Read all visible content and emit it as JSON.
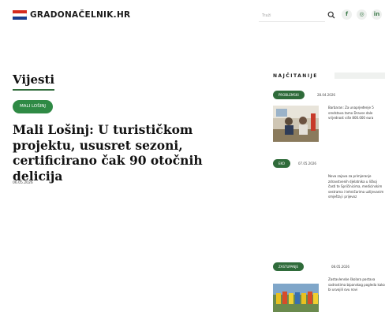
{
  "header": {
    "logo_text": "GRADONAČELNIK.HR",
    "search_placeholder": "Traži",
    "social": [
      {
        "icon": "facebook-icon",
        "glyph": "f"
      },
      {
        "icon": "instagram-icon",
        "glyph": "◎"
      },
      {
        "icon": "linkedin-icon",
        "glyph": "in"
      }
    ]
  },
  "main": {
    "section_title": "Vijesti",
    "category": "MALI LOŠINJ",
    "article_title": "Mali Lošinj: U turističkom projektu, ususret sezoni, certificirano čak 90 otočnih delicija",
    "article_date": "06.05.2026"
  },
  "sidebar": {
    "title": "NAJČITANIJE",
    "items": [
      {
        "category": "PROBLEMSKI",
        "date": "28.04.2026",
        "text": "Barbaran: Za unaprjeđenje 5 sredstava tamo Dravse dale vrijednost više 800.000 eura"
      },
      {
        "category": "EKO",
        "date": "07.05.2026",
        "text": "Nova zajava za primjeranje zdravstvenih djelatnika u ličkoj časti te Spričinicima, medicinskim sestrama i tehničarima uzlijevanim smještaj i prijevoz"
      },
      {
        "category": "ZASTUPANJE",
        "date": "08.05.2026",
        "text": "Zastavlenske školara postava sadrostima bipanskog pogleda kako bi usvojili ovu novi"
      }
    ]
  },
  "colors": {
    "accent": "#2f6b3a",
    "badge": "#2f8a45",
    "flag_red": "#d52b1e",
    "flag_white": "#ffffff",
    "flag_blue": "#1a3d8f"
  }
}
